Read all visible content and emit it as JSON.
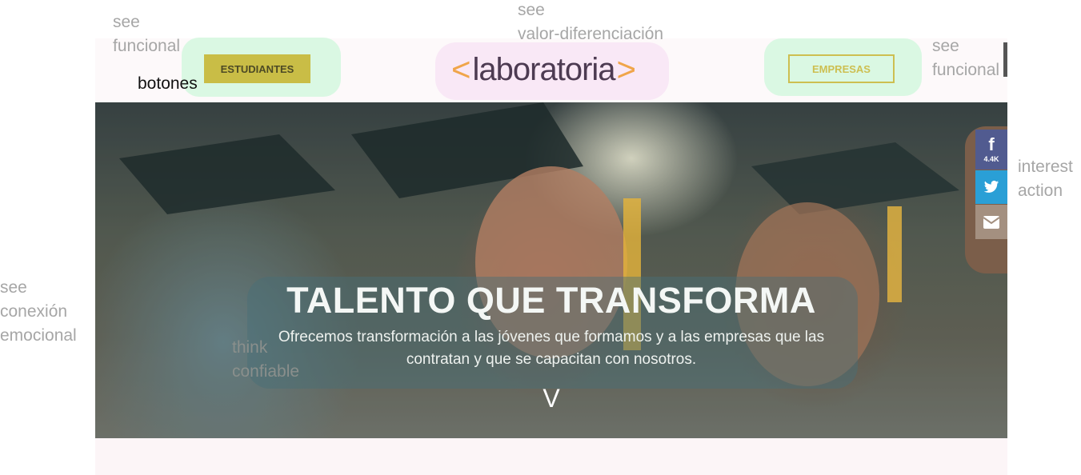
{
  "annotations": {
    "see_funcional_left": "see\nfuncional",
    "botones": "botones",
    "see_valor": "see\nvalor-diferenciación",
    "see_funcional_right": "see\nfuncional",
    "interest_action": "interest\naction",
    "see_conexion": "see\nconexión\nemocional",
    "think_confiable": "think\nconfiable"
  },
  "header": {
    "estudiantes_label": "ESTUDIANTES",
    "empresas_label": "EMPRESAS",
    "logo": {
      "left_bracket": "<",
      "text": "laboratoria",
      "right_bracket": ">"
    }
  },
  "hero": {
    "title": "TALENTO QUE TRANSFORMA",
    "subtitle": "Ofrecemos transformación a las jóvenes que formamos y a las empresas que las contratan y que se capacitan con nosotros.",
    "arrow": "V"
  },
  "share": {
    "facebook_count": "4.4K",
    "icons": [
      "facebook-icon",
      "twitter-icon",
      "email-icon"
    ]
  },
  "colors": {
    "estudiantes_bg": "#c9bd46",
    "empresas_border": "#cdbf51",
    "logo_bracket": "#f0a54a",
    "logo_text": "#4d3b52",
    "facebook": "#515b90",
    "twitter": "#2a9fd6",
    "email": "#a49080"
  }
}
